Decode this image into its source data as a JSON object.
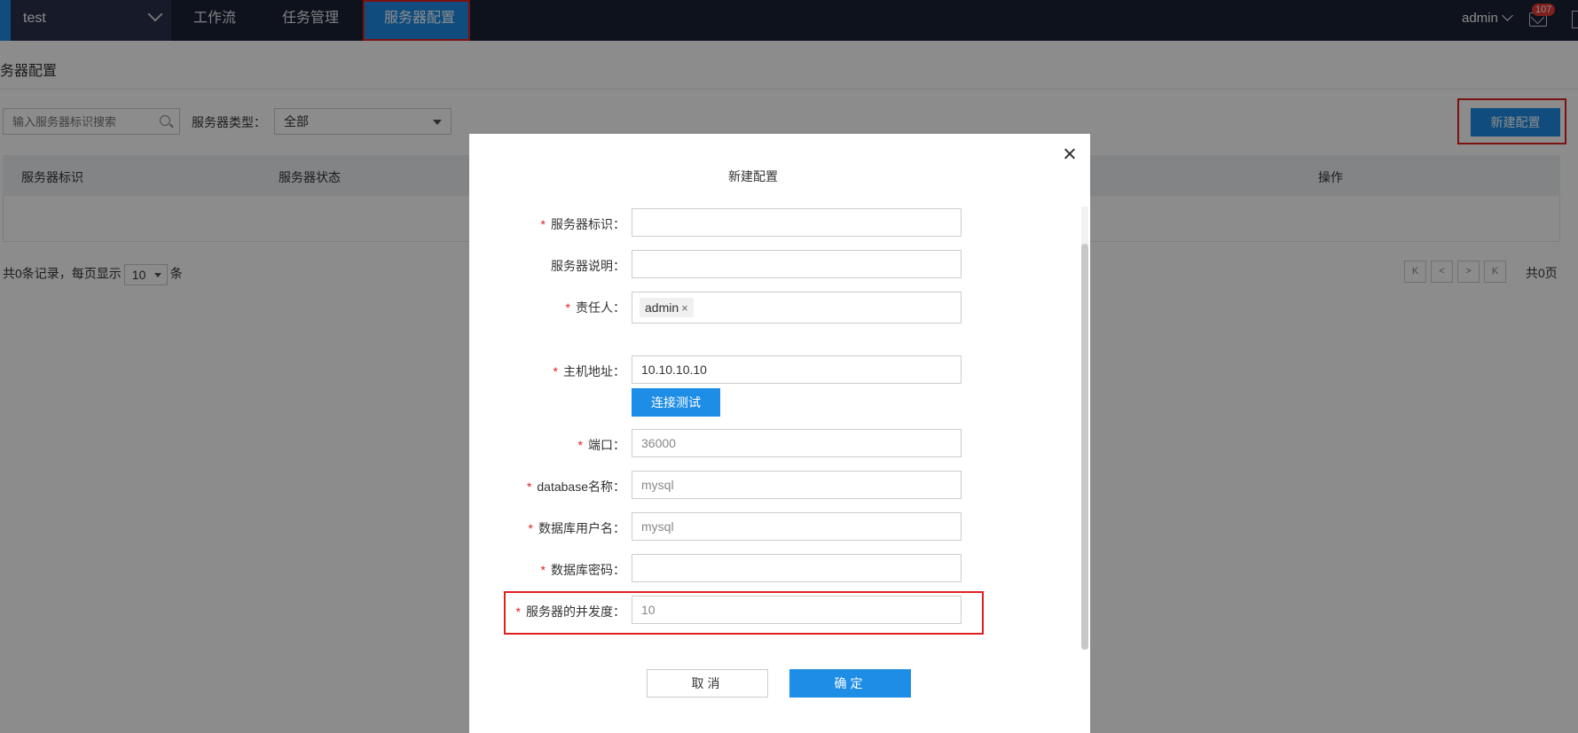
{
  "topbar": {
    "project": "test",
    "nav": [
      {
        "label": "工作流"
      },
      {
        "label": "任务管理"
      },
      {
        "label": "服务器配置",
        "active": true
      }
    ],
    "user": "admin",
    "notification_count": "107"
  },
  "page": {
    "title": "务器配置",
    "search_placeholder": "输入服务器标识搜索",
    "type_label": "服务器类型：",
    "type_value": "全部",
    "new_button": "新建配置",
    "table_headers": [
      "服务器标识",
      "服务器状态",
      "操作"
    ],
    "pager": {
      "total_text": "共0条记录，每页显示",
      "page_size": "10",
      "unit": "条",
      "total_pages": "共0页",
      "buttons": [
        "K",
        "<",
        ">",
        "K"
      ]
    }
  },
  "modal": {
    "title": "新建配置",
    "fields": [
      {
        "label": "服务器标识：",
        "required": true,
        "value": ""
      },
      {
        "label": "服务器说明：",
        "required": false,
        "value": ""
      },
      {
        "label": "责任人：",
        "required": true,
        "tag": "admin"
      },
      {
        "label": "主机地址：",
        "required": true,
        "value": "10.10.10.10"
      },
      {
        "label": "端口：",
        "required": true,
        "value": "36000"
      },
      {
        "label": "database名称：",
        "required": true,
        "value": "mysql"
      },
      {
        "label": "数据库用户名：",
        "required": true,
        "value": "mysql"
      },
      {
        "label": "数据库密码：",
        "required": true,
        "value": ""
      },
      {
        "label": "服务器的并发度：",
        "required": true,
        "value": "10"
      }
    ],
    "required_mark": "*",
    "tag_remove": "×",
    "connect_test": "连接测试",
    "cancel": "取消",
    "confirm": "确定"
  },
  "colors": {
    "topbar": "#1b2133",
    "primary": "#1e8de6",
    "highlight": "#e02020"
  }
}
